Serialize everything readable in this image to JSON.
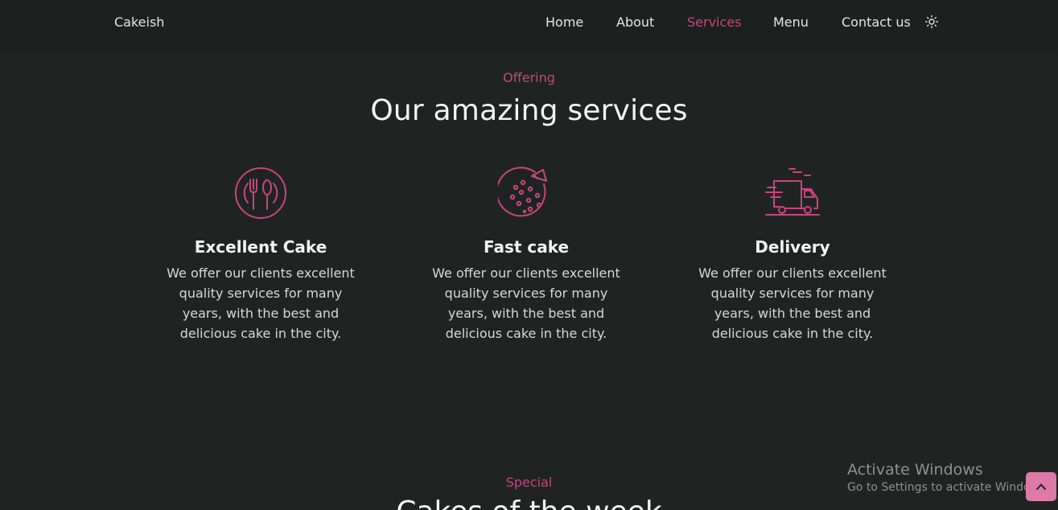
{
  "header": {
    "logo": "Cakeish",
    "nav": [
      {
        "label": "Home",
        "active": false
      },
      {
        "label": "About",
        "active": false
      },
      {
        "label": "Services",
        "active": true
      },
      {
        "label": "Menu",
        "active": false
      },
      {
        "label": "Contact us",
        "active": false
      }
    ],
    "theme_icon": "sun-icon"
  },
  "services": {
    "subtitle": "Offering",
    "title": "Our amazing services",
    "cards": [
      {
        "icon": "cutlery-plate-icon",
        "title": "Excellent Cake",
        "description": "We offer our clients excellent quality services for many years, with the best and delicious cake in the city."
      },
      {
        "icon": "pizza-icon",
        "title": "Fast cake",
        "description": "We offer our clients excellent quality services for many years, with the best and delicious cake in the city."
      },
      {
        "icon": "delivery-truck-icon",
        "title": "Delivery",
        "description": "We offer our clients excellent quality services for many years, with the best and delicious cake in the city."
      }
    ]
  },
  "special": {
    "subtitle": "Special",
    "title": "Cakes of the week"
  },
  "watermark": {
    "title": "Activate Windows",
    "subtitle": "Go to Settings to activate Windows."
  },
  "scroll_up_icon": "chevron-up-icon",
  "colors": {
    "background": "#1f2422",
    "accent": "#c9447f",
    "text": "#f3f4f3",
    "button": "#dd7aa7"
  }
}
